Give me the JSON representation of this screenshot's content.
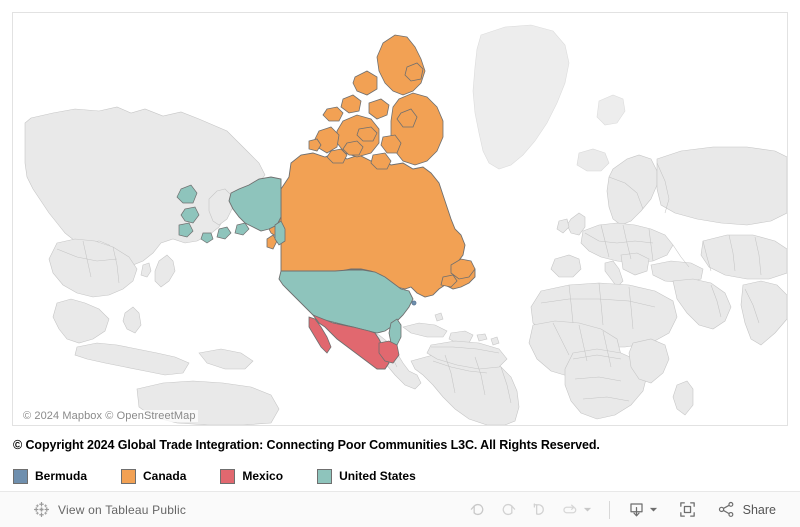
{
  "map": {
    "attribution": "© 2024 Mapbox  © OpenStreetMap",
    "background_color": "#ffffff",
    "land_color": "#e8e8e8",
    "border_color": "#b4b4b4",
    "highlight_border_color": "#6f6f6f"
  },
  "caption": {
    "text": "© Copyright 2024 Global Trade Integration: Connecting Poor Communities L3C. All Rights Reserved."
  },
  "legend": {
    "items": [
      {
        "label": "Bermuda",
        "color": "#6f8fae"
      },
      {
        "label": "Canada",
        "color": "#f2a154"
      },
      {
        "label": "Mexico",
        "color": "#e1686f"
      },
      {
        "label": "United States",
        "color": "#8ec4bc"
      }
    ]
  },
  "toolbar": {
    "view_on_label": "View on Tableau Public",
    "logo_icon": "tableau-logo-icon",
    "buttons": [
      {
        "name": "undo-button",
        "icon": "undo-icon"
      },
      {
        "name": "redo-button",
        "icon": "redo-icon"
      },
      {
        "name": "revert-button",
        "icon": "revert-icon"
      },
      {
        "name": "refresh-button",
        "icon": "refresh-icon",
        "has_caret": true
      },
      {
        "name": "download-button",
        "icon": "download-icon",
        "has_caret": true
      },
      {
        "name": "fullscreen-button",
        "icon": "fullscreen-icon"
      }
    ],
    "share_label": "Share",
    "share_icon": "share-icon"
  }
}
